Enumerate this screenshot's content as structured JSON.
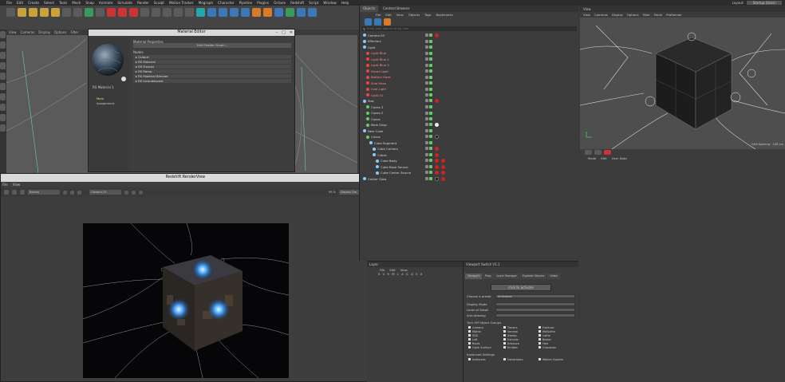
{
  "menubar": {
    "items": [
      "File",
      "Edit",
      "Create",
      "Select",
      "Tools",
      "Mesh",
      "Snap",
      "Animate",
      "Simulate",
      "Render",
      "Sculpt",
      "Motion Tracker",
      "Mograph",
      "Character",
      "Pipeline",
      "Plugins",
      "Octane",
      "Redshift",
      "Script",
      "Window",
      "Help"
    ],
    "layout_label": "Layout:",
    "layout_value": "Startup (User)"
  },
  "left_viewport": {
    "menu": [
      "View",
      "Cameras",
      "Display",
      "Options",
      "Filter"
    ]
  },
  "material_editor": {
    "title": "Material Editor",
    "material_name": "RS Material 1",
    "section_title": "Material Properties",
    "edit_button": "Edit Shader Graph...",
    "nodes_label": "Nodes",
    "nodes": [
      "Output",
      "RS Material",
      "RS Fresnel",
      "RS Ramp",
      "RS Material Blender",
      "RS Incandescent"
    ],
    "left_items": [
      "Main",
      "Assignment"
    ]
  },
  "render_view": {
    "title": "Redshift RenderView",
    "menu": [
      "File",
      "View"
    ],
    "beauty_value": "Beauty",
    "camera_value": "Camera.13",
    "zoom_value": "95 %",
    "display_value": "Display Gm"
  },
  "object_manager": {
    "tabs": [
      "Objects",
      "Content Browser"
    ],
    "menu": [
      "File",
      "Edit",
      "View",
      "Objects",
      "Tags",
      "Bookmarks"
    ],
    "search_placeholder": "Enter your search string here",
    "rows": [
      {
        "name": "Camera 03",
        "indent": 0,
        "icon": "#8cf",
        "red": false,
        "mats": [
          "r"
        ]
      },
      {
        "name": "Effectors",
        "indent": 0,
        "icon": "#8cf",
        "red": false,
        "mats": []
      },
      {
        "name": "Light",
        "indent": 0,
        "icon": "#8cf",
        "red": false,
        "mats": []
      },
      {
        "name": "Light Blue",
        "indent": 1,
        "icon": "#e44",
        "red": true,
        "mats": []
      },
      {
        "name": "Light Blue 2",
        "indent": 1,
        "icon": "#e44",
        "red": true,
        "mats": []
      },
      {
        "name": "Light Blue 3",
        "indent": 1,
        "icon": "#e44",
        "red": true,
        "mats": []
      },
      {
        "name": "Ghost Light",
        "indent": 1,
        "icon": "#e44",
        "red": true,
        "mats": []
      },
      {
        "name": "Bottom Haze",
        "indent": 1,
        "icon": "#e44",
        "red": true,
        "mats": []
      },
      {
        "name": "Side Haze",
        "indent": 1,
        "icon": "#e44",
        "red": true,
        "mats": []
      },
      {
        "name": "Cool Light",
        "indent": 1,
        "icon": "#e44",
        "red": true,
        "mats": []
      },
      {
        "name": "Light 01",
        "indent": 1,
        "icon": "#e44",
        "red": true,
        "mats": []
      },
      {
        "name": "Stat",
        "indent": 0,
        "icon": "#8cf",
        "red": false,
        "mats": [
          "r"
        ]
      },
      {
        "name": "Cones 3",
        "indent": 1,
        "icon": "#6c6",
        "red": false,
        "mats": []
      },
      {
        "name": "Cones 2",
        "indent": 1,
        "icon": "#6c6",
        "red": false,
        "mats": []
      },
      {
        "name": "Cones",
        "indent": 1,
        "icon": "#6c6",
        "red": false,
        "mats": []
      },
      {
        "name": "Main Shop",
        "indent": 1,
        "icon": "#6c6",
        "red": false,
        "mats": [
          "w"
        ]
      },
      {
        "name": "New Cube",
        "indent": 0,
        "icon": "#8cf",
        "red": false,
        "mats": []
      },
      {
        "name": "Cones",
        "indent": 1,
        "icon": "#6c6",
        "red": false,
        "mats": [
          "k"
        ]
      },
      {
        "name": "Cube Segment",
        "indent": 2,
        "icon": "#8cf",
        "red": false,
        "mats": []
      },
      {
        "name": "Cube Corners",
        "indent": 3,
        "icon": "#8cf",
        "red": false,
        "mats": [
          "r"
        ]
      },
      {
        "name": "Cubes",
        "indent": 3,
        "icon": "#8cf",
        "red": false,
        "mats": [
          "r"
        ]
      },
      {
        "name": "Cube Body",
        "indent": 4,
        "icon": "#8cf",
        "red": false,
        "mats": [
          "r",
          "r"
        ]
      },
      {
        "name": "Cube Base Source",
        "indent": 4,
        "icon": "#8cf",
        "red": false,
        "mats": [
          "r",
          "r"
        ]
      },
      {
        "name": "Cube Center Source",
        "indent": 4,
        "icon": "#8cf",
        "red": false,
        "mats": [
          "r",
          "r"
        ]
      },
      {
        "name": "Center Glow",
        "indent": 0,
        "icon": "#8cf",
        "red": false,
        "mats": [
          "k",
          "r"
        ]
      }
    ]
  },
  "right_viewport": {
    "tab": "View",
    "menu": [
      "View",
      "Cameras",
      "Display",
      "Options",
      "Filter",
      "Panel",
      "ProRender"
    ],
    "grid_spacing": "Grid Spacing : 100 cm"
  },
  "attributes": {
    "menu": [
      "Mode",
      "Edit",
      "User Data"
    ]
  },
  "layer_panel": {
    "title": "Layer",
    "menu": [
      "File",
      "Edit",
      "View"
    ],
    "letters": "S V R M L A G D E X"
  },
  "viewport_switch": {
    "title": "Viewport Switch V1.1",
    "tabs": [
      "Viewport",
      "Prog",
      "Layer Manager",
      "Explode Objects",
      "Video"
    ],
    "activate_button": "click to activate",
    "choose_preset_label": "Choose a preset",
    "choose_preset_value": "Animation",
    "fields": [
      "Display Mode",
      "Level of Detail",
      "Anti-Aliasing"
    ],
    "groups_title": "Turn Off Object Groups",
    "groups": [
      [
        "Camera",
        "Tracers",
        "Fracture"
      ],
      [
        "Matrix",
        "Voronoi",
        "MoSpline"
      ],
      [
        "SDS",
        "Sweep",
        "Lathe"
      ],
      [
        "Loft",
        "Extrude",
        "Bezier"
      ],
      [
        "Bools",
        "Instance",
        "Hair"
      ],
      [
        "Cloth Surface",
        "Emitter",
        "Character"
      ]
    ],
    "instanced_title": "Instanced Settings",
    "instanced": [
      "Instances",
      "Generators",
      "Motion System"
    ]
  }
}
